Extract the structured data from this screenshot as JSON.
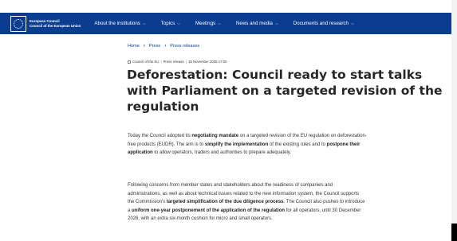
{
  "header": {
    "logo_line1": "European Council",
    "logo_line2": "Council of the European Union",
    "nav": [
      {
        "label": "About the institutions",
        "has_menu": true
      },
      {
        "label": "Topics",
        "has_menu": true
      },
      {
        "label": "Meetings",
        "has_menu": true
      },
      {
        "label": "News and media",
        "has_menu": true
      },
      {
        "label": "Documents and research",
        "has_menu": true
      }
    ],
    "chevron": "⌵",
    "brand_color": "#0a3d8f"
  },
  "breadcrumb": {
    "items": [
      "Home",
      "Press",
      "Press releases"
    ],
    "separator": "›"
  },
  "meta": {
    "source": "Council of the EU",
    "type": "Press release",
    "datetime": "19 November 2025 17:00",
    "divider": "|"
  },
  "article": {
    "title": "Deforestation: Council ready to start talks with Parliament on a targeted revision of the regulation",
    "p1": [
      {
        "t": "Today the Council adopted its ",
        "b": false
      },
      {
        "t": "negotiating mandate",
        "b": true
      },
      {
        "t": " on a targeted revision of the EU regulation on deforestation-free products (EUDR). The aim is to ",
        "b": false
      },
      {
        "t": "simplify the implementation",
        "b": true
      },
      {
        "t": " of the existing rules and to ",
        "b": false
      },
      {
        "t": "postpone their application",
        "b": true
      },
      {
        "t": " to allow operators, traders and authorities to prepare adequately.",
        "b": false
      }
    ],
    "p2": [
      {
        "t": "Following concerns from member states and stakeholders about the readiness of companies and administrations, as well as about technical issues related to the new information system, the Council supports the Commission's ",
        "b": false
      },
      {
        "t": "targeted simplification of the due diligence process",
        "b": true
      },
      {
        "t": ". The Council also pushes to introduce a ",
        "b": false
      },
      {
        "t": "uniform one-year postponement of the application of the regulation",
        "b": true
      },
      {
        "t": " for all operators, until 30 December 2026, with an extra six-month cushion for micro and small operators.",
        "b": false
      }
    ]
  }
}
